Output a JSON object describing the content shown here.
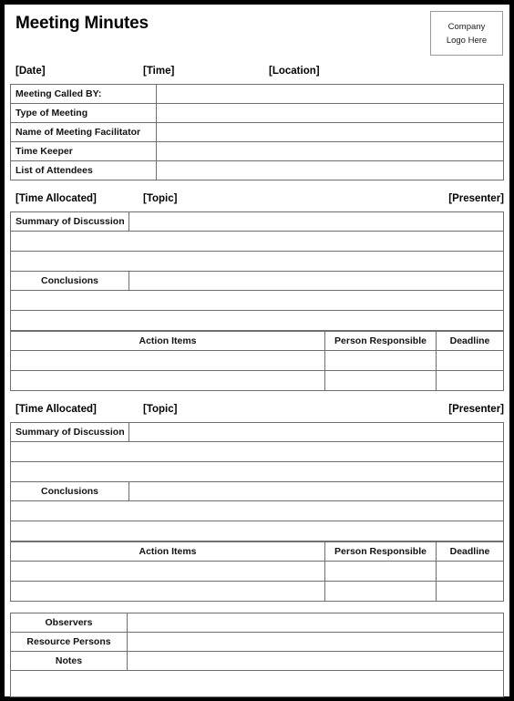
{
  "document": {
    "title": "Meeting Minutes",
    "logo": {
      "line1": "Company",
      "line2": "Logo Here"
    }
  },
  "meta_row": {
    "date": "[Date]",
    "time": "[Time]",
    "location": "[Location]"
  },
  "info_table": {
    "rows": [
      {
        "label": "Meeting Called BY:",
        "value": ""
      },
      {
        "label": "Type of Meeting",
        "value": ""
      },
      {
        "label": "Name of Meeting Facilitator",
        "value": ""
      },
      {
        "label": "Time Keeper",
        "value": ""
      },
      {
        "label": "List of Attendees",
        "value": ""
      }
    ]
  },
  "topics": [
    {
      "header": {
        "time_allocated": "[Time Allocated]",
        "topic": "[Topic]",
        "presenter": "[Presenter]"
      },
      "summary_label": "Summary of Discussion",
      "summary_value": "",
      "summary_blank_rows": [
        "",
        ""
      ],
      "conclusions_label": "Conclusions",
      "conclusions_value": "",
      "conclusions_blank_rows": [
        "",
        ""
      ],
      "action_table": {
        "headers": [
          "Action Items",
          "Person Responsible",
          "Deadline"
        ],
        "rows": [
          [
            "",
            "",
            ""
          ],
          [
            "",
            "",
            ""
          ]
        ]
      }
    },
    {
      "header": {
        "time_allocated": "[Time Allocated]",
        "topic": "[Topic]",
        "presenter": "[Presenter]"
      },
      "summary_label": "Summary of Discussion",
      "summary_value": "",
      "summary_blank_rows": [
        "",
        ""
      ],
      "conclusions_label": "Conclusions",
      "conclusions_value": "",
      "conclusions_blank_rows": [
        "",
        ""
      ],
      "action_table": {
        "headers": [
          "Action Items",
          "Person Responsible",
          "Deadline"
        ],
        "rows": [
          [
            "",
            "",
            ""
          ],
          [
            "",
            "",
            ""
          ]
        ]
      }
    }
  ],
  "footer_table": {
    "rows": [
      {
        "label": "Observers",
        "value": ""
      },
      {
        "label": "Resource Persons",
        "value": ""
      },
      {
        "label": "Notes",
        "value": ""
      }
    ],
    "trailing_blank_row": ""
  },
  "colors": {
    "page_border": "#000000",
    "cell_border": "#6e6e6e",
    "shaded_cell": "#f7f2f4",
    "logo_border": "#9a9a9a",
    "text": "#000000"
  }
}
